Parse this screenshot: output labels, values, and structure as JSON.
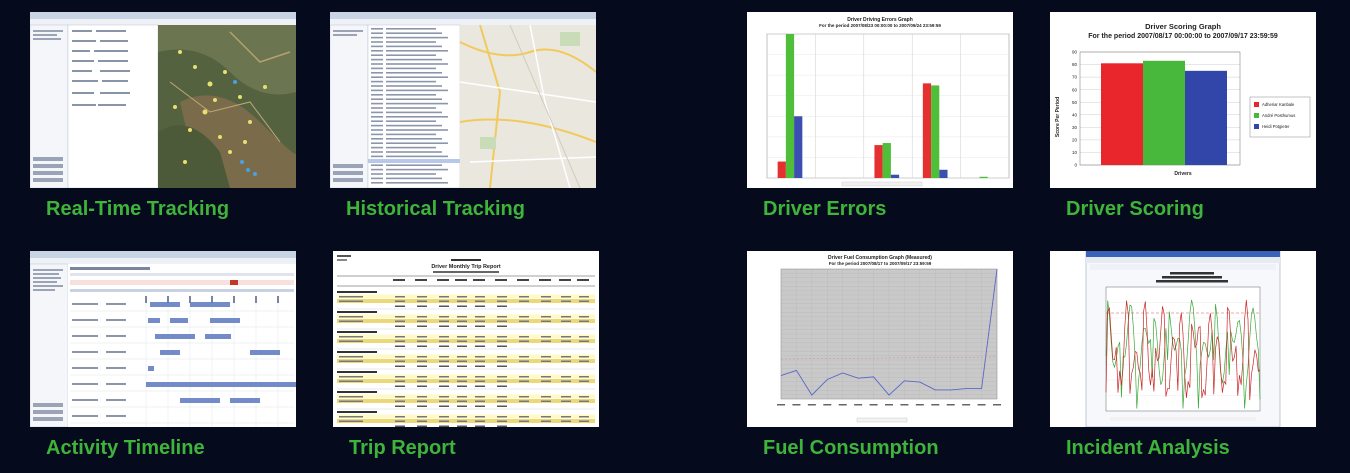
{
  "tiles": [
    {
      "id": "realtime",
      "caption": "Real-Time Tracking"
    },
    {
      "id": "historical",
      "caption": "Historical Tracking"
    },
    {
      "id": "errors",
      "caption": "Driver Errors",
      "chart": {
        "title": "Driver Driving Errors Graph",
        "subtitle": "For the period 2007/08/23 00:00:00 to 2007/09/24 23:59:59"
      }
    },
    {
      "id": "scoring",
      "caption": "Driver Scoring",
      "chart": {
        "title": "Driver Scoring Graph",
        "subtitle": "For the period 2007/08/17 00:00:00 to 2007/09/17 23:59:59",
        "ylabel": "Score Per Period",
        "xlabel": "Drivers",
        "legend": [
          "Adheriar Kanbale",
          "André Posthumus",
          "Heidi Potgieter"
        ]
      }
    },
    {
      "id": "timeline",
      "caption": "Activity Timeline"
    },
    {
      "id": "trip",
      "caption": "Trip Report",
      "report": {
        "title": "Driver Monthly Trip Report"
      }
    },
    {
      "id": "fuel",
      "caption": "Fuel Consumption",
      "chart": {
        "title": "Driver Fuel Consumption Graph (Measured)",
        "subtitle": "For the period 2007/08/17 to 2007/09/17 23:59:59"
      }
    },
    {
      "id": "incident",
      "caption": "Incident Analysis"
    }
  ],
  "chart_data": [
    {
      "type": "bar",
      "title": "Driver Driving Errors Graph",
      "subtitle": "For the period 2007/08/23 00:00:00 to 2007/09/24 23:59:59",
      "ylim": [
        0,
        350
      ],
      "series": [
        {
          "color": "#e53030",
          "values": [
            40,
            0,
            80,
            230,
            0
          ]
        },
        {
          "color": "#4fbf3a",
          "values": [
            350,
            0,
            85,
            225,
            3
          ]
        },
        {
          "color": "#3a4fb0",
          "values": [
            150,
            0,
            8,
            20,
            0
          ]
        }
      ]
    },
    {
      "type": "bar",
      "title": "Driver Scoring Graph",
      "subtitle": "For the period 2007/08/17 00:00:00 to 2007/09/17 23:59:59",
      "xlabel": "Drivers",
      "ylabel": "Score Per Period",
      "yticks": [
        0,
        10,
        20,
        30,
        40,
        50,
        60,
        70,
        80,
        90
      ],
      "ylim": [
        0,
        90
      ],
      "series": [
        {
          "name": "Adheriar Kanbale",
          "color": "#e8262c",
          "values": [
            81
          ]
        },
        {
          "name": "André Posthumus",
          "color": "#48b83c",
          "values": [
            83
          ]
        },
        {
          "name": "Heidi Potgieter",
          "color": "#3146a8",
          "values": [
            75
          ]
        }
      ]
    },
    {
      "type": "line",
      "title": "Driver Fuel Consumption Graph (Measured)",
      "subtitle": "For the period 2007/08/17 to 2007/09/17 23:59:59",
      "series": [
        {
          "color": "#5a66c8",
          "values": [
            18,
            22,
            3,
            15,
            20,
            16,
            17,
            3,
            14,
            13,
            7,
            7,
            8,
            8,
            100
          ]
        }
      ]
    }
  ]
}
